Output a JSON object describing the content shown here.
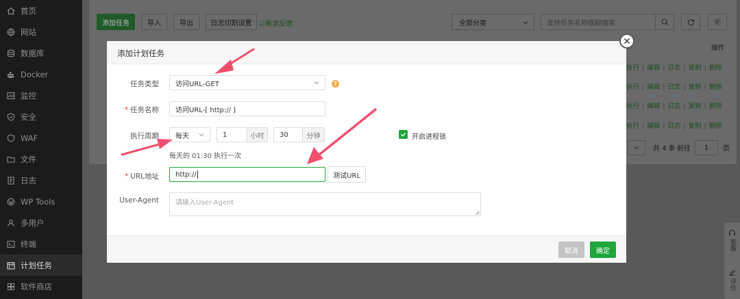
{
  "sidebar": {
    "items": [
      {
        "label": "首页",
        "icon": "home-icon"
      },
      {
        "label": "网站",
        "icon": "globe-icon"
      },
      {
        "label": "数据库",
        "icon": "database-icon"
      },
      {
        "label": "Docker",
        "icon": "docker-icon"
      },
      {
        "label": "监控",
        "icon": "monitor-icon"
      },
      {
        "label": "安全",
        "icon": "shield-icon"
      },
      {
        "label": "WAF",
        "icon": "waf-shield-icon"
      },
      {
        "label": "文件",
        "icon": "folder-icon"
      },
      {
        "label": "日志",
        "icon": "log-icon"
      },
      {
        "label": "WP Tools",
        "icon": "wordpress-icon"
      },
      {
        "label": "多用户",
        "icon": "users-icon"
      },
      {
        "label": "终端",
        "icon": "terminal-icon"
      },
      {
        "label": "计划任务",
        "icon": "calendar-icon",
        "active": true
      },
      {
        "label": "软件商店",
        "icon": "store-icon"
      }
    ]
  },
  "toolbar": {
    "add_task": "添加任务",
    "import": "导入",
    "export": "导出",
    "log_cut_settings": "日志切割设置",
    "feedback": "需求反馈",
    "category": "全部分类",
    "search_placeholder": "支持任务名称模糊搜索"
  },
  "table": {
    "actions_header": "操作",
    "row_actions": [
      "执行",
      "编辑",
      "日志",
      "复制",
      "删除"
    ],
    "rows": 4
  },
  "pager": {
    "total": "共 4 条",
    "goto": "前往",
    "page": "1",
    "page_unit": "页"
  },
  "float_panel": {
    "service": "客服",
    "review": "评价"
  },
  "dialog": {
    "title": "添加计划任务",
    "task_type_label": "任务类型",
    "task_type_value": "访问URL-GET",
    "task_name_label": "任务名称",
    "task_name_value": "访问URL-[ http:// ]",
    "period_label": "执行周期",
    "period_value": "每天",
    "hour_value": "1",
    "hour_unit": "小时",
    "minute_value": "30",
    "minute_unit": "分钟",
    "process_lock": "开启进程锁",
    "schedule_hint": "每天的 01:30 执行一次",
    "url_label": "URL地址",
    "url_value": "http://",
    "test_url": "测试URL",
    "ua_label": "User-Agent",
    "ua_placeholder": "请输入User-Agent",
    "cancel": "取消",
    "confirm": "确定"
  },
  "colors": {
    "accent": "#20a53a",
    "required": "#e53b3b",
    "arrow": "#f0506e",
    "help": "#f0ad4e"
  }
}
